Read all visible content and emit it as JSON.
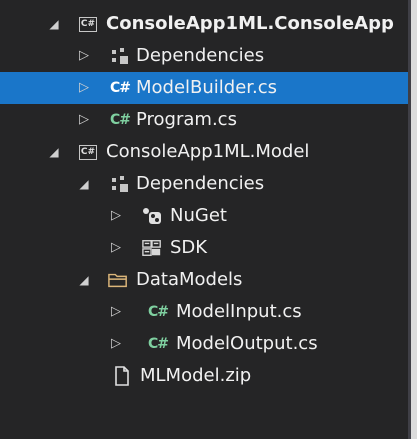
{
  "tree": {
    "items": [
      {
        "label": "ConsoleApp1ML.ConsoleApp",
        "icon": "csharp-project-icon",
        "expanded": true
      },
      {
        "label": "Dependencies",
        "icon": "dependencies-icon",
        "expanded": false
      },
      {
        "label": "ModelBuilder.cs",
        "icon": "csharp-file-icon",
        "expanded": false,
        "selected": true
      },
      {
        "label": "Program.cs",
        "icon": "csharp-file-icon",
        "expanded": false
      },
      {
        "label": "ConsoleApp1ML.Model",
        "icon": "csharp-project-icon",
        "expanded": true
      },
      {
        "label": "Dependencies",
        "icon": "dependencies-icon",
        "expanded": true
      },
      {
        "label": "NuGet",
        "icon": "nuget-icon",
        "expanded": false
      },
      {
        "label": "SDK",
        "icon": "sdk-icon",
        "expanded": false
      },
      {
        "label": "DataModels",
        "icon": "folder-icon",
        "expanded": true
      },
      {
        "label": "ModelInput.cs",
        "icon": "csharp-file-icon",
        "expanded": false
      },
      {
        "label": "ModelOutput.cs",
        "icon": "csharp-file-icon",
        "expanded": false
      },
      {
        "label": "MLModel.zip",
        "icon": "file-icon"
      }
    ],
    "csproj_glyph": "C#",
    "cs_glyph": "C#"
  },
  "colors": {
    "background": "#252526",
    "selection": "#1a76c9",
    "text": "#f1f1f1",
    "csharp_accent": "#7fd0a0"
  }
}
